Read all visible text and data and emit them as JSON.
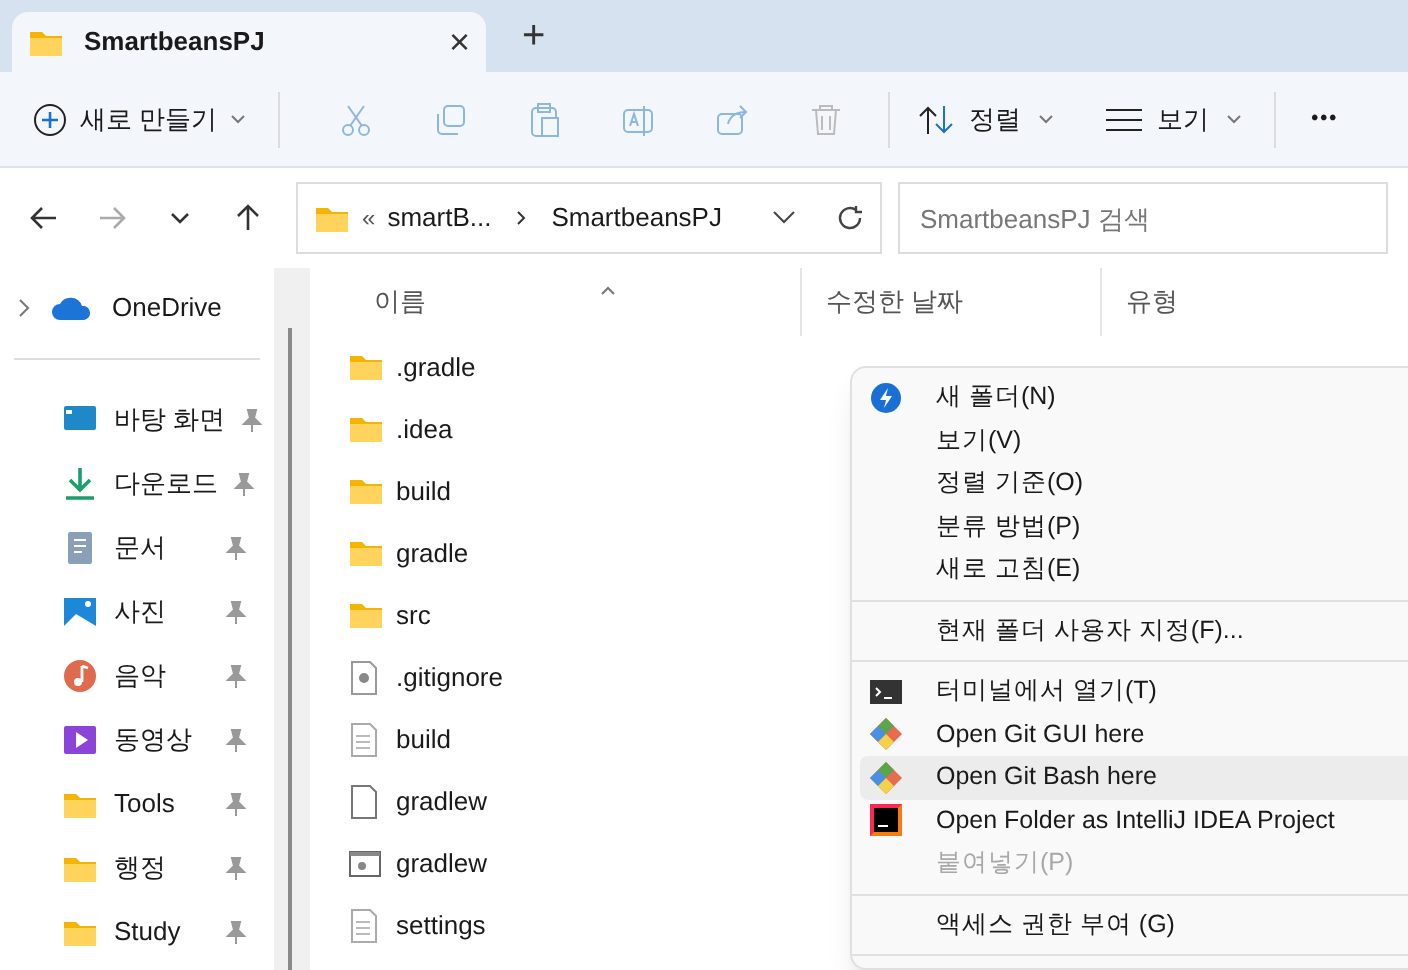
{
  "tabs": [
    {
      "label": "SmartbeansPJ",
      "selected": true,
      "close": "×"
    }
  ],
  "new_tab": "+",
  "toolbar": {
    "new": "새로 만들기",
    "sort": "정렬",
    "view": "보기",
    "more": "•••"
  },
  "address": {
    "overflow": "«",
    "crumbs": [
      "smartB...",
      "SmartbeansPJ"
    ]
  },
  "search": {
    "placeholder": "SmartbeansPJ 검색"
  },
  "sidebar": {
    "top": {
      "label": "OneDrive"
    },
    "items": [
      {
        "label": "바탕 화면",
        "kind": "desktop"
      },
      {
        "label": "다운로드",
        "kind": "download"
      },
      {
        "label": "문서",
        "kind": "document"
      },
      {
        "label": "사진",
        "kind": "photo"
      },
      {
        "label": "음악",
        "kind": "music"
      },
      {
        "label": "동영상",
        "kind": "video"
      },
      {
        "label": "Tools",
        "kind": "folder"
      },
      {
        "label": "행정",
        "kind": "folder"
      },
      {
        "label": "Study",
        "kind": "folder"
      }
    ]
  },
  "columns": [
    "이름",
    "수정한 날짜",
    "유형"
  ],
  "files": [
    {
      "name": ".gradle",
      "kind": "folder"
    },
    {
      "name": ".idea",
      "kind": "folder"
    },
    {
      "name": "build",
      "kind": "folder"
    },
    {
      "name": "gradle",
      "kind": "folder"
    },
    {
      "name": "src",
      "kind": "folder"
    },
    {
      "name": ".gitignore",
      "kind": "config"
    },
    {
      "name": "build",
      "kind": "text"
    },
    {
      "name": "gradlew",
      "kind": "blank"
    },
    {
      "name": "gradlew",
      "kind": "script"
    },
    {
      "name": "settings",
      "kind": "text"
    }
  ],
  "context_menu": [
    {
      "label": "새 폴더(N)",
      "kind": "bolt",
      "disabled": false,
      "selected": false
    },
    {
      "label": "보기(V)",
      "disabled": false,
      "selected": false
    },
    {
      "label": "정렬 기준(O)",
      "disabled": false,
      "selected": false
    },
    {
      "label": "분류 방법(P)",
      "disabled": false,
      "selected": false
    },
    {
      "label": "새로 고침(E)",
      "disabled": false,
      "selected": false,
      "separator_after": true
    },
    {
      "label": "현재 폴더 사용자 지정(F)...",
      "disabled": false,
      "selected": false,
      "separator_after": true
    },
    {
      "label": "터미널에서 열기(T)",
      "kind": "terminal",
      "disabled": false,
      "selected": false
    },
    {
      "label": "Open Git GUI here",
      "kind": "git",
      "disabled": false,
      "selected": false
    },
    {
      "label": "Open Git Bash here",
      "kind": "git",
      "disabled": false,
      "selected": true
    },
    {
      "label": "Open Folder as IntelliJ IDEA Project",
      "kind": "idea",
      "disabled": false,
      "selected": false
    },
    {
      "label": "붙여넣기(P)",
      "disabled": true,
      "selected": false,
      "separator_after": true
    },
    {
      "label": "액세스 권한 부여 (G)",
      "disabled": false,
      "selected": false,
      "separator_after": true
    }
  ]
}
